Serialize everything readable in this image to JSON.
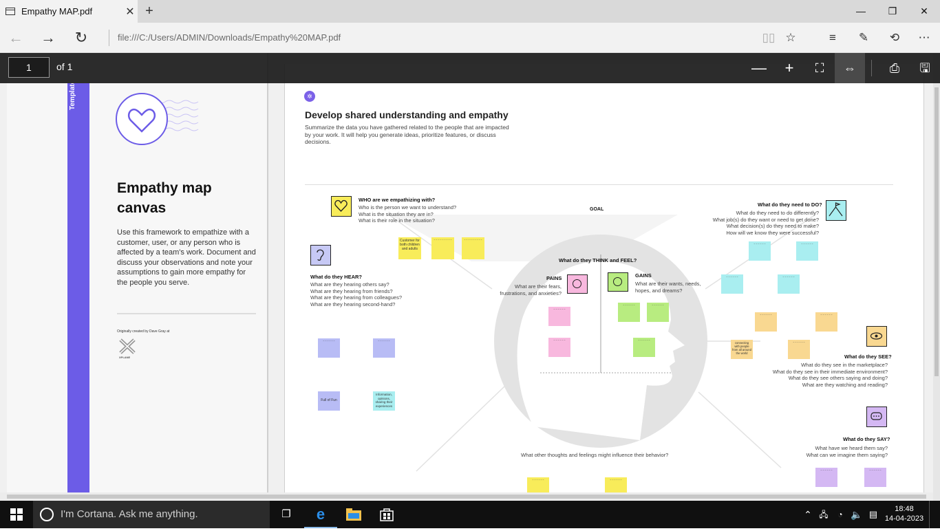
{
  "browser": {
    "tab_title": "Empathy MAP.pdf",
    "tab_close": "✕",
    "new_tab": "+",
    "url": "file:///C:/Users/ADMIN/Downloads/Empathy%20MAP.pdf",
    "window": {
      "minimize": "—",
      "maximize": "❐",
      "close": "✕"
    }
  },
  "pdf_toolbar": {
    "page_value": "1",
    "page_of": "of 1"
  },
  "doc": {
    "template_label": "Template",
    "title": "Empathy map canvas",
    "description": "Use this framework to empathize with a customer, user, or any person who is affected by a team's work. Document and discuss your observations and note your assumptions to gain more empathy for the people you serve.",
    "credit": "Originally created by Dave Gray at",
    "xplane": "XPLANE",
    "heading": "Develop shared understanding and empathy",
    "subheading": "Summarize the data you have gathered related to the people that are impacted by your work. It will help you generate ideas, prioritize features, or discuss decisions.",
    "goal": "GOAL",
    "who_head": "WHO are we empathizing with?",
    "who_q": [
      "Who is the person we want to understand?",
      "What is the situation they are in?",
      "What is their role in the situation?"
    ],
    "do_head": "What do they need to DO?",
    "do_q": [
      "What do they need to do differently?",
      "What job(s) do they want or need to get done?",
      "What decision(s) do they need to make?",
      "How will we know they were successful?"
    ],
    "hear_head": "What do they HEAR?",
    "hear_q": [
      "What are they hearing others say?",
      "What are they hearing from friends?",
      "What are they hearing from colleagues?",
      "What are they hearing second-hand?"
    ],
    "think_head": "What do they THINK and FEEL?",
    "pains_head": "PAINS",
    "pains_q": "What are their fears, frustrations, and anxieties?",
    "gains_head": "GAINS",
    "gains_q": "What are their wants, needs, hopes, and dreams?",
    "see_head": "What do they SEE?",
    "see_q": [
      "What do they see in the marketplace?",
      "What do they see in their immediate environment?",
      "What do they see others saying and doing?",
      "What are they watching and reading?"
    ],
    "say_head": "What do they SAY?",
    "say_q": [
      "What have we heard them say?",
      "What can we imagine them saying?"
    ],
    "other_q": "What other thoughts and feelings might influence their behavior?",
    "stickies": {
      "who1": "Customer for both children and adults",
      "hear_pull": "Full of Fun",
      "hear_info": "Information, opinions, sharing their experiences",
      "see_connect": "connecting with people from all around the world"
    }
  },
  "taskbar": {
    "cortana": "I'm Cortana. Ask me anything.",
    "time": "18:48",
    "date": "14-04-2023"
  }
}
